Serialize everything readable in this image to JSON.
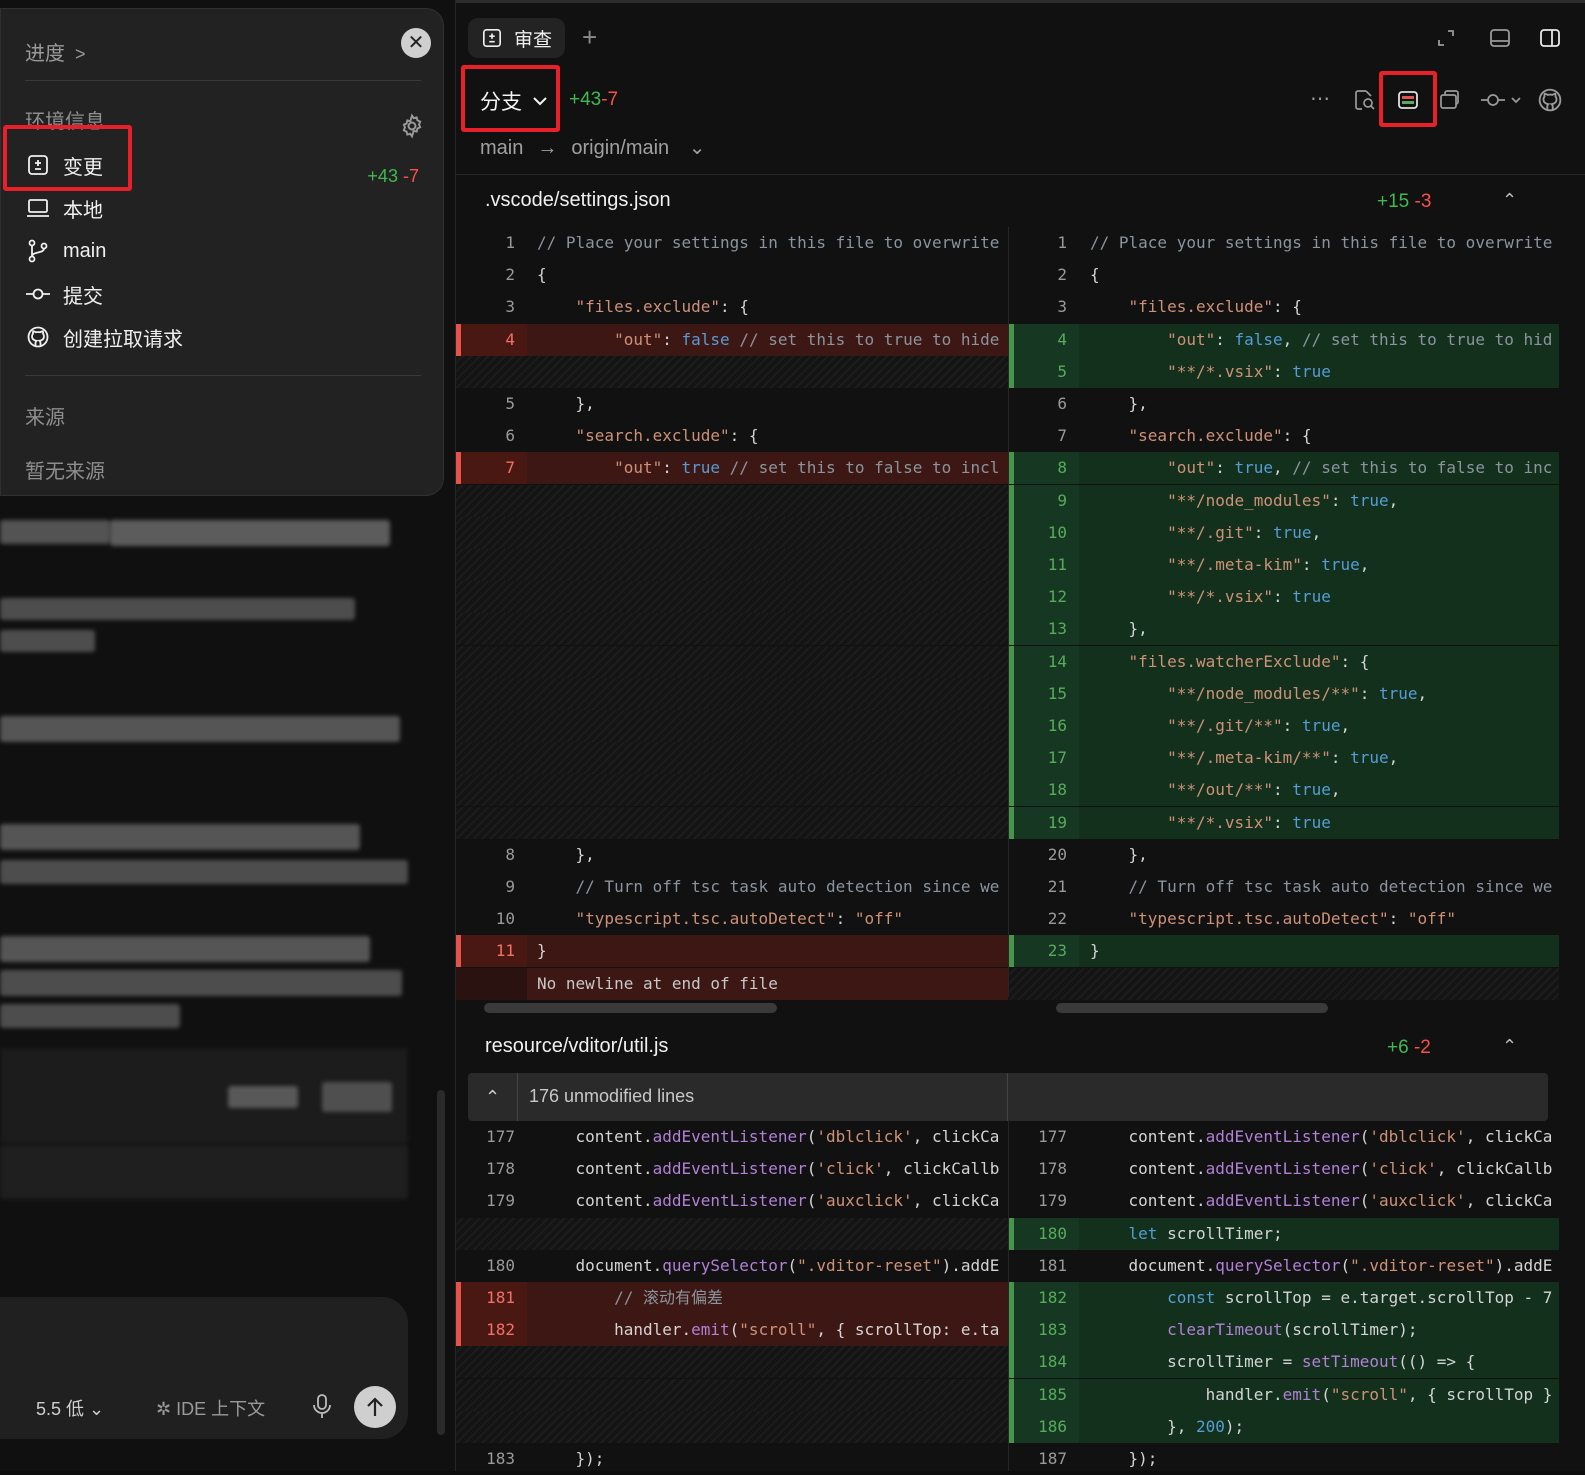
{
  "left_panel": {
    "progress_label": "进度",
    "env_label": "环境信息",
    "nav": [
      {
        "label": "变更",
        "icon": "diff-icon"
      },
      {
        "label": "本地",
        "icon": "laptop-icon"
      },
      {
        "label": "main",
        "icon": "git-branch-icon"
      },
      {
        "label": "提交",
        "icon": "git-commit-icon"
      },
      {
        "label": "创建拉取请求",
        "icon": "github-icon"
      }
    ],
    "changes_added": "+43",
    "changes_removed": "-7",
    "sources_label": "来源",
    "no_sources": "暂无来源"
  },
  "composer": {
    "model": "5.5 低",
    "ide_context": "IDE 上下文"
  },
  "review": {
    "tab_label": "审查",
    "branch_dropdown": "分支",
    "added": "+43",
    "removed": "-7",
    "base_branch": "main",
    "arrow": "→",
    "target_branch": "origin/main"
  },
  "files": [
    {
      "name": ".vscode/settings.json",
      "added": "+15",
      "removed": "-3",
      "left_lines": [
        "1",
        "2",
        "3",
        "4",
        "5",
        "6",
        "7",
        "8",
        "9",
        "10",
        "11"
      ],
      "right_lines": [
        "1",
        "2",
        "3",
        "4",
        "5",
        "6",
        "7",
        "8",
        "9",
        "10",
        "11",
        "12",
        "13",
        "14",
        "15",
        "16",
        "17",
        "18",
        "19",
        "20",
        "21",
        "22",
        "23"
      ],
      "no_newline_note": "No newline at end of file"
    },
    {
      "name": "resource/vditor/util.js",
      "added": "+6",
      "removed": "-2",
      "unmodified": "176 unmodified lines",
      "left_lines": [
        "177",
        "178",
        "179",
        "180",
        "181",
        "182",
        "183"
      ],
      "right_lines": [
        "177",
        "178",
        "179",
        "180",
        "181",
        "182",
        "183",
        "184",
        "185",
        "186",
        "187"
      ],
      "comment": "// 滚动有偏差"
    }
  ],
  "colors": {
    "added": "#3fb950",
    "removed": "#f85149",
    "highlight_box": "#e8202a"
  }
}
